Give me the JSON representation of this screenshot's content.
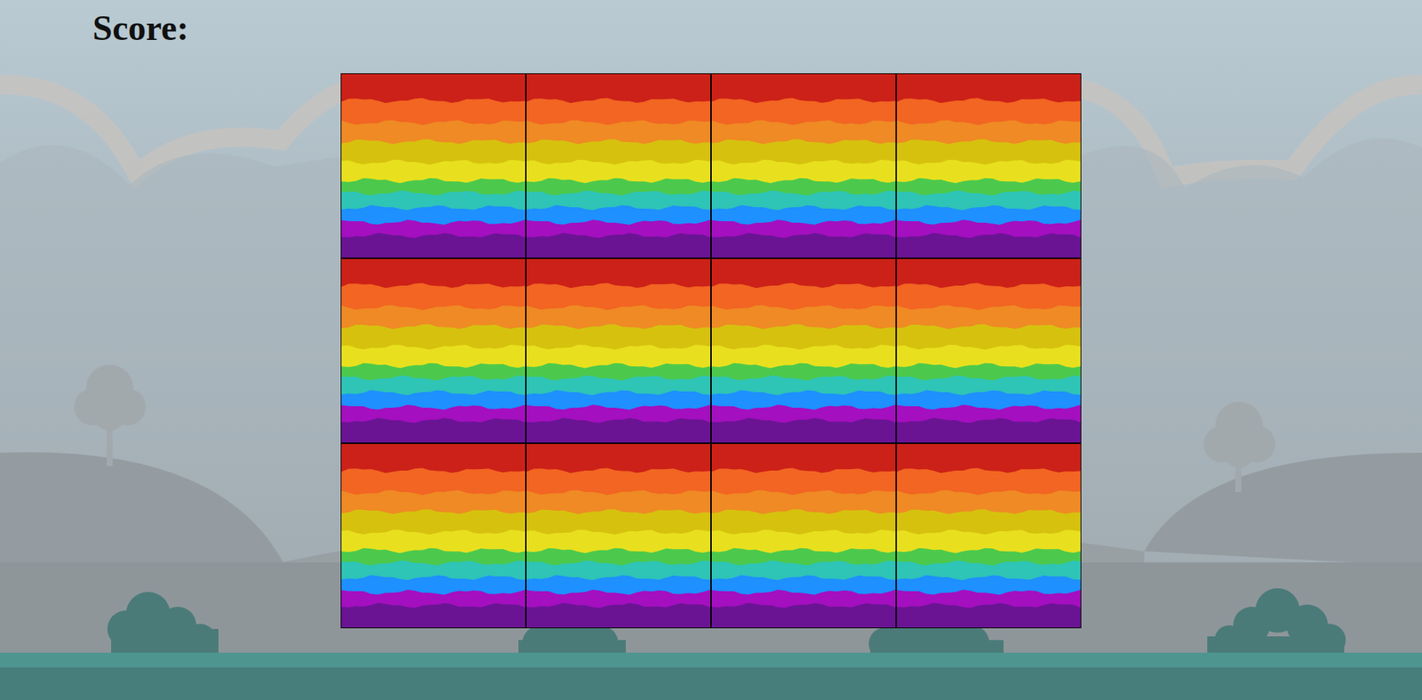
{
  "score": {
    "label": "Score:"
  },
  "cards": [
    {
      "flipped": false
    },
    {
      "flipped": false
    },
    {
      "flipped": false
    },
    {
      "flipped": false
    },
    {
      "flipped": false
    },
    {
      "flipped": false
    },
    {
      "flipped": false
    },
    {
      "flipped": false
    },
    {
      "flipped": false
    },
    {
      "flipped": false
    },
    {
      "flipped": false
    },
    {
      "flipped": false
    }
  ]
}
